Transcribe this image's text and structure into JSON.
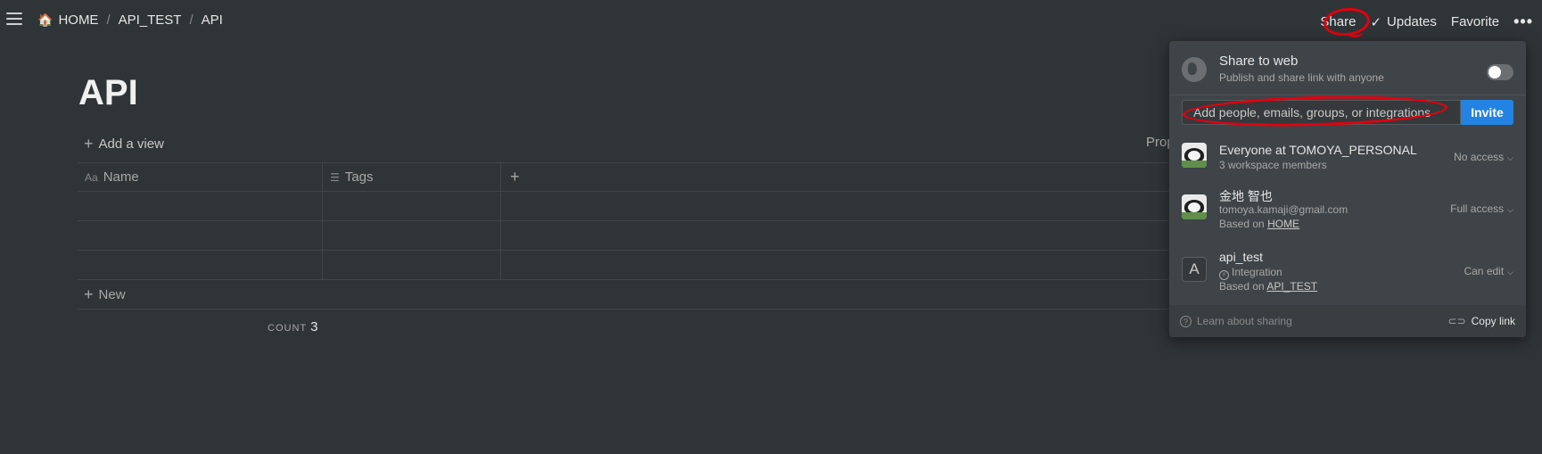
{
  "topbar": {
    "breadcrumb": [
      {
        "label": "HOME",
        "emoji": "🏠"
      },
      {
        "label": "API_TEST"
      },
      {
        "label": "API"
      }
    ],
    "separator": "/",
    "share_label": "Share",
    "updates_label": "Updates",
    "favorite_label": "Favorite",
    "more_label": "•••"
  },
  "page": {
    "title": "API",
    "add_view_label": "Add a view",
    "properties_label_partial": "Prop",
    "table": {
      "columns": [
        {
          "label": "Name",
          "icon": "Aa"
        },
        {
          "label": "Tags",
          "icon": "list-icon"
        },
        {
          "label": "+",
          "icon": "plus-icon"
        }
      ],
      "rows": [
        [
          "",
          ""
        ],
        [
          "",
          ""
        ],
        [
          "",
          ""
        ]
      ],
      "new_label": "New",
      "count_label": "COUNT",
      "count_value": "3"
    }
  },
  "share_popup": {
    "web_title": "Share to web",
    "web_subtitle": "Publish and share link with anyone",
    "web_enabled": false,
    "invite_placeholder": "Add people, emails, groups, or integrations",
    "invite_button": "Invite",
    "members": [
      {
        "name": "Everyone at TOMOYA_PERSONAL",
        "sub": "3 workspace members",
        "access": "No access"
      },
      {
        "name": "金地 智也",
        "sub": "tomoya.kamaji@gmail.com",
        "based_on_prefix": "Based on",
        "based_on": "HOME",
        "access": "Full access"
      },
      {
        "name": "api_test",
        "avatar_letter": "A",
        "sub": "Integration",
        "based_on_prefix": "Based on",
        "based_on": "API_TEST",
        "access": "Can edit"
      }
    ],
    "learn_label": "Learn about sharing",
    "copy_link_label": "Copy link"
  },
  "annotation_color": "#e3000f"
}
